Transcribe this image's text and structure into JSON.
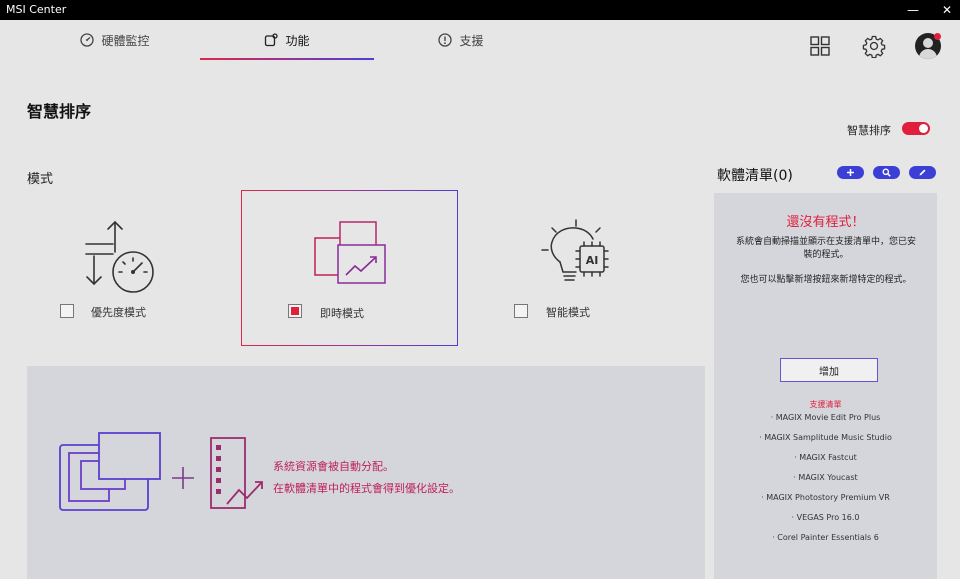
{
  "window": {
    "title": "MSI Center",
    "min_glyph": "—",
    "close_glyph": "✕"
  },
  "nav": {
    "tabs": [
      {
        "label": "硬體監控",
        "icon": "gauge-icon"
      },
      {
        "label": "功能",
        "icon": "feature-icon",
        "active": true
      },
      {
        "label": "支援",
        "icon": "alert-icon"
      }
    ],
    "right_icons": [
      "grid-icon",
      "gear-icon",
      "avatar"
    ],
    "accent_gradient": [
      "#e0284a",
      "#4d3fd8"
    ]
  },
  "page": {
    "title": "智慧排序",
    "toggle_label": "智慧排序",
    "toggle_on": true,
    "section_label": "模式"
  },
  "modes": [
    {
      "label": "優先度模式",
      "checked": false,
      "icon": "priority-gauge-icon"
    },
    {
      "label": "即時模式",
      "checked": true,
      "icon": "realtime-windows-icon"
    },
    {
      "label": "智能模式",
      "checked": false,
      "icon": "ai-bulb-icon"
    }
  ],
  "info": {
    "line1": "系統資源會被自動分配。",
    "line2": "在軟體清單中的程式會得到優化設定。"
  },
  "sidebar": {
    "title": "軟體清單(0)",
    "buttons": [
      "plus-icon",
      "search-icon",
      "edit-icon"
    ],
    "empty_title": "還沒有程式！",
    "desc1": "系統會自動掃描並顯示在支援清單中，您已安裝的程式。",
    "desc2": "您也可以點擊新增按鈕來新增特定的程式。",
    "add_label": "增加",
    "support_title": "支援清單",
    "support_list": [
      "· MAGIX Movie Edit Pro Plus",
      "· MAGIX Samplitude Music Studio",
      "· MAGIX Fastcut",
      "· MAGIX Youcast",
      "· MAGIX Photostory Premium VR",
      "· VEGAS Pro 16.0",
      "· Corel Painter Essentials 6"
    ]
  },
  "colors": {
    "red": "#e01f3d",
    "blue": "#3b3fd6",
    "panel": "#d4d6db",
    "bg": "#e6e6e6"
  }
}
